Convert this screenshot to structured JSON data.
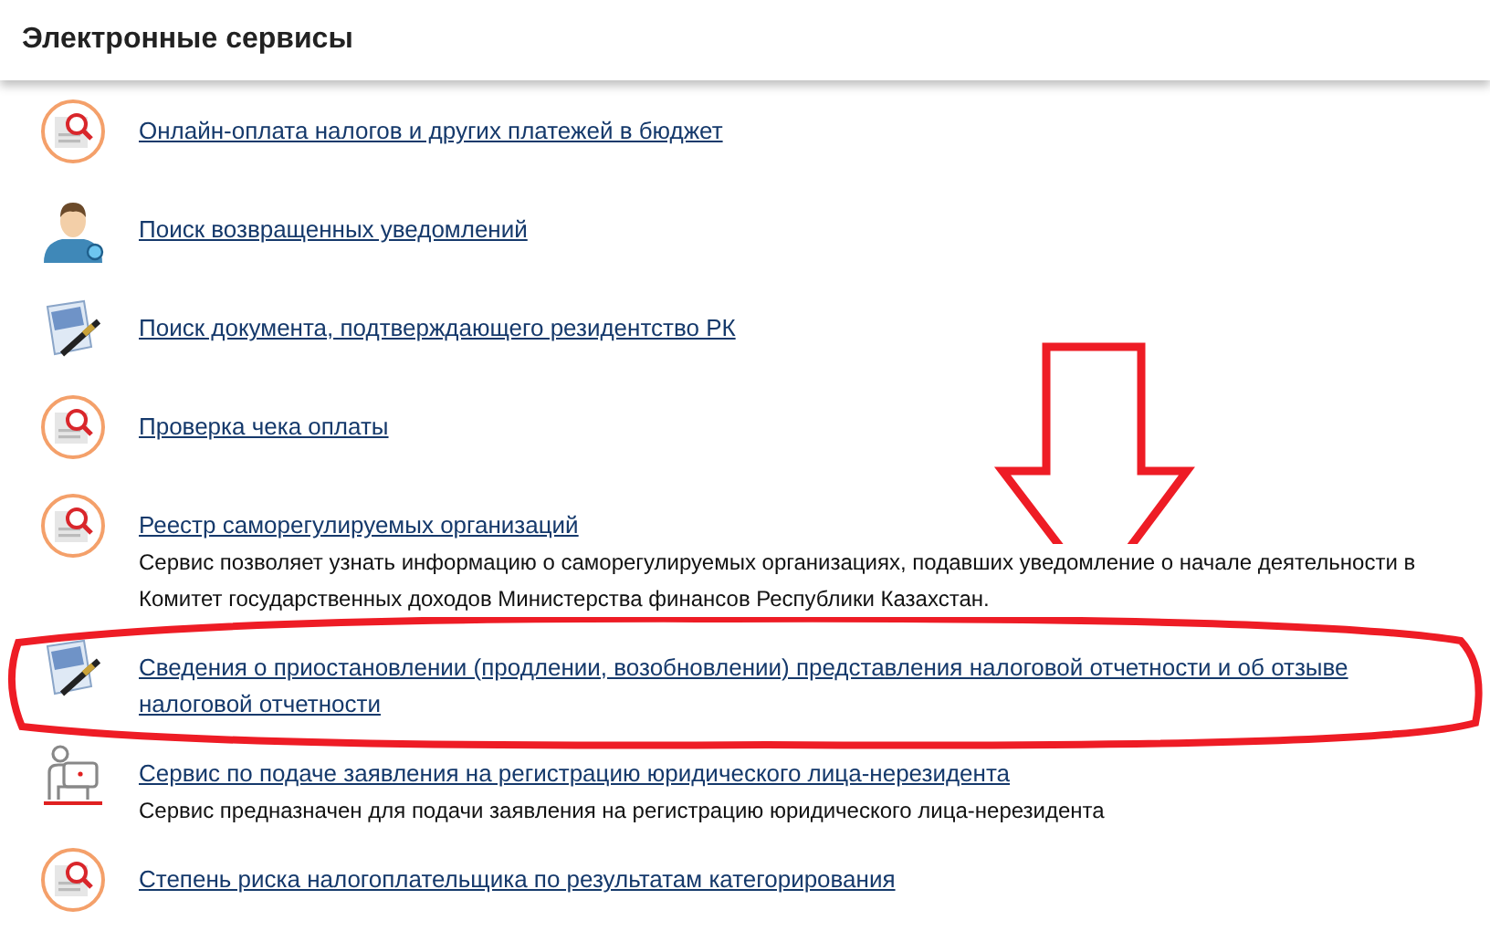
{
  "header": {
    "title": "Электронные сервисы"
  },
  "services": [
    {
      "kind": "search-doc",
      "link": "Онлайн-оплата налогов и других платежей в бюджет"
    },
    {
      "kind": "user",
      "link": "Поиск возвращенных уведомлений"
    },
    {
      "kind": "pen-doc",
      "link": "Поиск документа, подтверждающего резидентство РК"
    },
    {
      "kind": "search-doc",
      "link": "Проверка чека оплаты"
    },
    {
      "kind": "search-doc",
      "link": "Реестр саморегулируемых организаций",
      "description": "Сервис позволяет узнать информацию о саморегулируемых организациях, подавших уведомление о начале деятельности в Комитет государственных доходов Министерства финансов Республики Казахстан."
    },
    {
      "kind": "pen-doc",
      "link": "Сведения о приостановлении (продлении, возобновлении) представления налоговой отчетности и об отзыве налоговой отчетности"
    },
    {
      "kind": "person-desk",
      "link": "Сервис по подаче заявления на регистрацию юридического лица-нерезидента",
      "description": "Сервис предназначен для подачи заявления на регистрацию юридического лица-нерезидента"
    },
    {
      "kind": "search-doc",
      "link": "Степень риска налогоплательщика по результатам категорирования"
    }
  ]
}
